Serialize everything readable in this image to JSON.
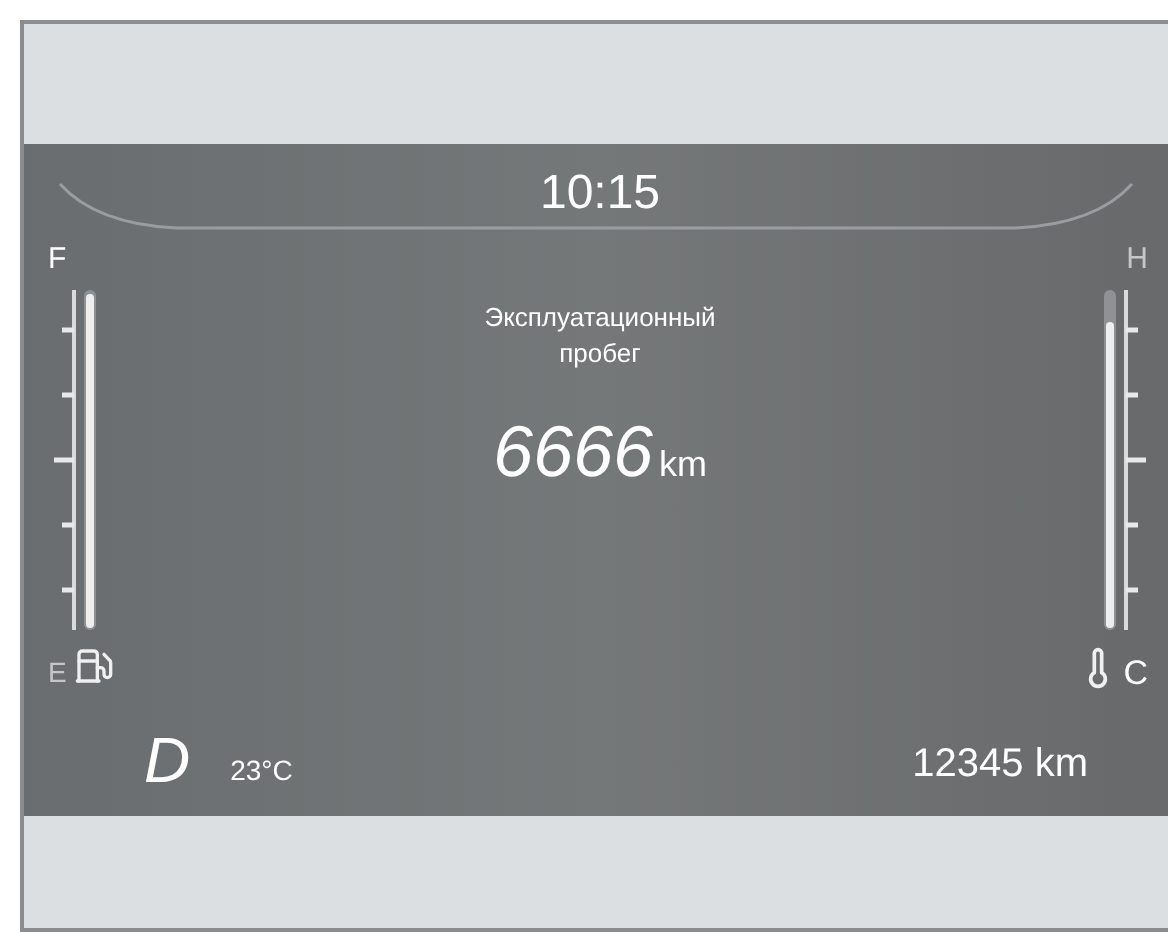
{
  "clock": "10:15",
  "fuel_gauge": {
    "full_label": "F",
    "empty_label": "E",
    "level": 0.98
  },
  "temp_gauge": {
    "hot_label": "H",
    "cold_label": "C",
    "level": 0.9
  },
  "info": {
    "title": "Эксплуатационный пробег",
    "value": "6666",
    "unit": "km"
  },
  "gear": "D",
  "outside_temp": "23°C",
  "odometer": "12345 km"
}
